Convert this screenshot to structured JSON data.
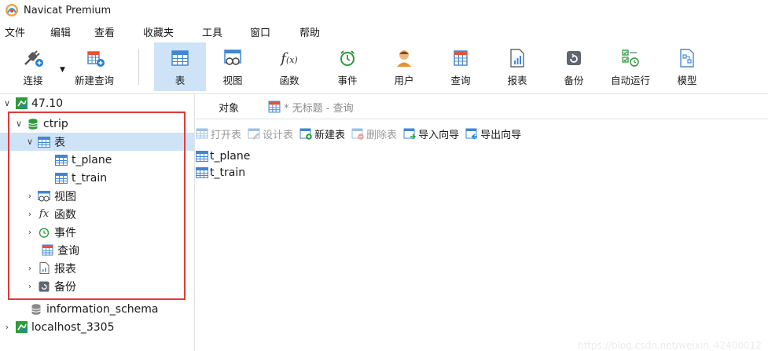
{
  "window": {
    "title": "Navicat Premium"
  },
  "menu": [
    "文件",
    "编辑",
    "查看",
    "收藏夹",
    "工具",
    "窗口",
    "帮助"
  ],
  "toolbar": {
    "connect": "连接",
    "new_query": "新建查询",
    "items": [
      "表",
      "视图",
      "函数",
      "事件",
      "用户",
      "查询",
      "报表",
      "备份",
      "自动运行",
      "模型"
    ]
  },
  "tree": {
    "connection1": "47.10",
    "db_ctrip": "ctrip",
    "tables": "表",
    "t_plane": "t_plane",
    "t_train": "t_train",
    "views": "视图",
    "functions": "函数",
    "events": "事件",
    "queries": "查询",
    "reports": "报表",
    "backups": "备份",
    "db_info": "information_schema",
    "connection2": "localhost_3305"
  },
  "tabs": {
    "objects": "对象",
    "query_tab": "* 无标题 - 查询"
  },
  "object_toolbar": {
    "open": "打开表",
    "design": "设计表",
    "new": "新建表",
    "delete": "删除表",
    "import": "导入向导",
    "export": "导出向导"
  },
  "table_list": [
    "t_plane",
    "t_train"
  ],
  "watermark": "https://blog.csdn.net/weixin_42400012",
  "colors": {
    "selection": "#cfe3f7",
    "highlight_box": "#e03a3a",
    "accent": "#1e7fd8"
  }
}
